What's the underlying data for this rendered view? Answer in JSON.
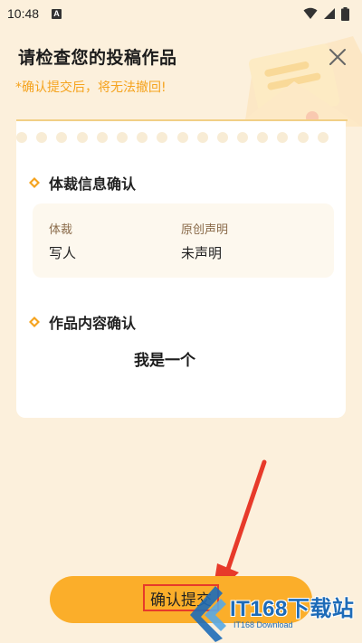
{
  "status_bar": {
    "time": "10:48",
    "notification_letter": "A"
  },
  "header": {
    "title": "请检查您的投稿作品",
    "warning": "*确认提交后，将无法撤回!"
  },
  "genre_section": {
    "title": "体裁信息确认",
    "genre_label": "体裁",
    "genre_value": "写人",
    "originality_label": "原创声明",
    "originality_value": "未声明"
  },
  "content_section": {
    "title": "作品内容确认",
    "content": "我是一个"
  },
  "confirm_button": {
    "label": "确认提交"
  },
  "watermark": {
    "brand": "IT168下载站",
    "sub": "IT168 Download"
  },
  "colors": {
    "accent": "#fbae2a",
    "warning": "#f5a31e",
    "background": "#fcf0dc",
    "arrow": "#e73a2a"
  }
}
